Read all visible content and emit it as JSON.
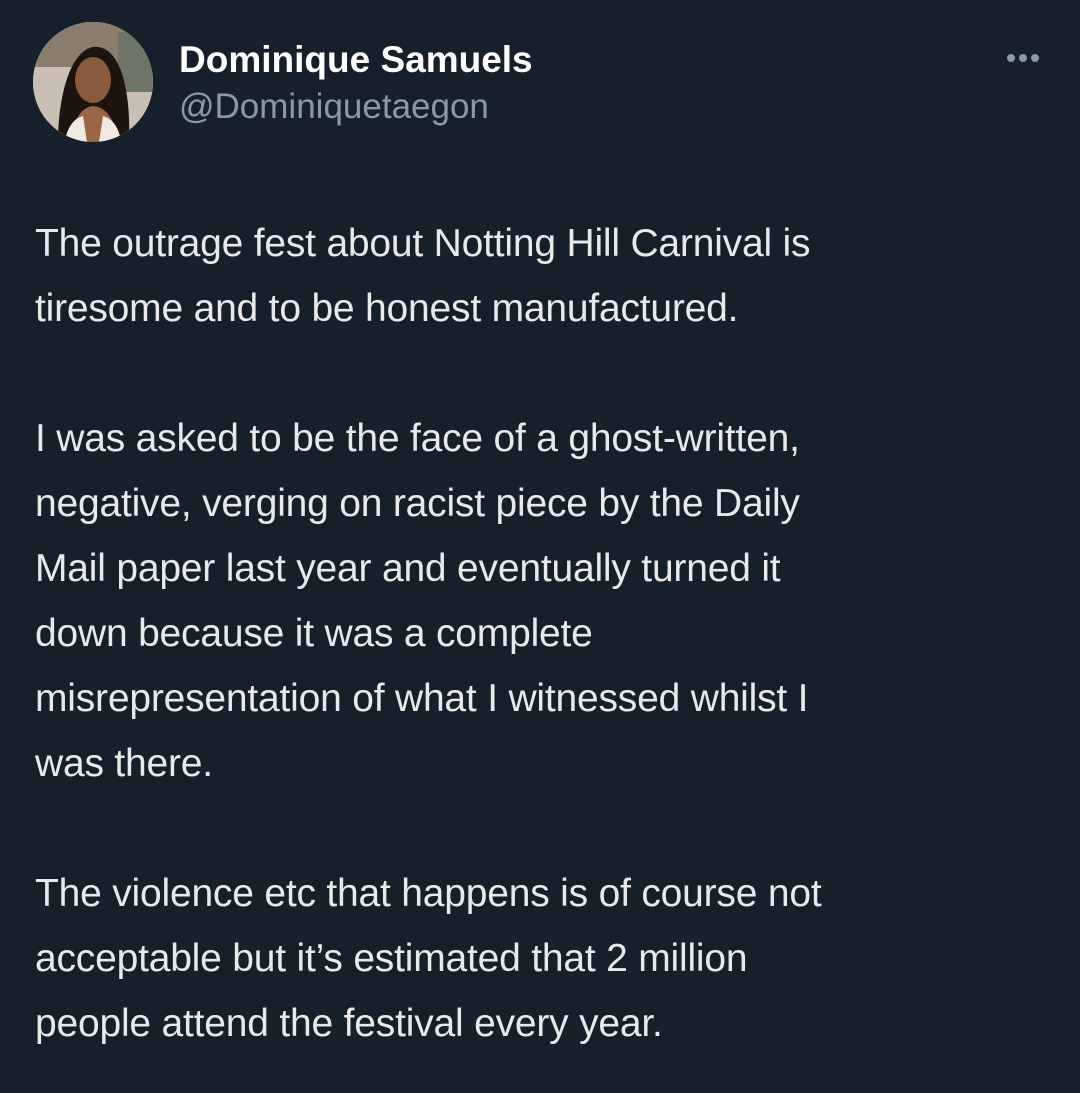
{
  "author": {
    "display_name": "Dominique Samuels",
    "handle": "@Dominiquetaegon"
  },
  "icons": {
    "avatar": "profile-photo",
    "more": "more-horizontal-icon"
  },
  "colors": {
    "background": "#15202b",
    "primary_text": "#e7e9ea",
    "secondary_text": "#8b98a5"
  },
  "tweet": {
    "paragraphs": [
      "The outrage fest about Notting Hill Carnival is\ntiresome and to be honest manufactured.",
      "I was asked to be the face of a ghost-written,\nnegative, verging on racist piece by the Daily\nMail paper last year and eventually turned it\ndown because it was a complete\nmisrepresentation of what I witnessed whilst I\nwas there.",
      "The violence etc that happens is of course not\nacceptable but it’s estimated that 2 million\npeople attend the festival every year."
    ]
  }
}
